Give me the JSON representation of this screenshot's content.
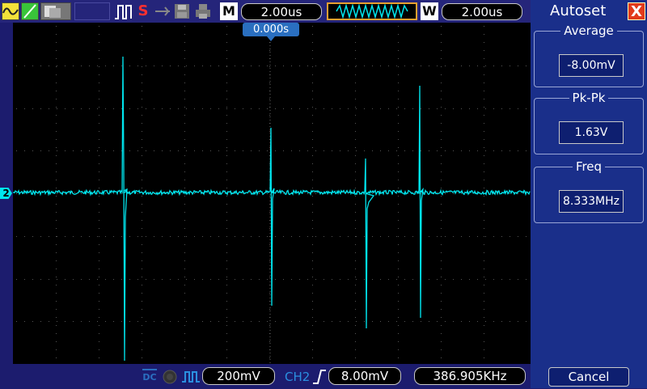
{
  "toolbar": {
    "timebase": "2.00us",
    "window_timebase": "2.00us",
    "m_label": "M",
    "w_label": "W",
    "run_state": "S"
  },
  "trigger": {
    "time_offset": "0.000s",
    "channel": "CH2",
    "level": "8.00mV"
  },
  "channel": {
    "marker": "2",
    "coupling": "DC",
    "scale": "200mV"
  },
  "frequency_readout": "386.905KHz",
  "panel": {
    "title": "Autoset",
    "close": "X",
    "measurements": [
      {
        "label": "Average",
        "value": "-8.00mV"
      },
      {
        "label": "Pk-Pk",
        "value": "1.63V"
      },
      {
        "label": "Freq",
        "value": "8.333MHz"
      }
    ],
    "cancel": "Cancel"
  },
  "colors": {
    "trace": "#00e5ee",
    "accent": "#2a6fc0",
    "close": "#e23b1b"
  }
}
